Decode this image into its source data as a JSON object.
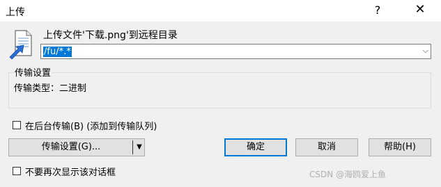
{
  "window": {
    "title": "上传",
    "help_glyph": "?",
    "close_glyph": "✕"
  },
  "header": {
    "icon": "upload-file-icon",
    "text": "上传文件'下载.png'到远程目录"
  },
  "path": {
    "value": "/fu/*.*"
  },
  "settings": {
    "group_title": "传输设置",
    "transfer_type": "传输类型：二进制"
  },
  "options": {
    "background_label": "在后台传输(B) (添加到传输队列)",
    "background_checked": false,
    "no_show_label": "不要再次显示该对话框",
    "no_show_checked": false
  },
  "buttons": {
    "transfer_settings": "传输设置(G)...",
    "ok": "确定",
    "cancel": "取消",
    "help": "帮助(H)"
  },
  "watermark": "CSDN @海鸥爱上鱼",
  "colors": {
    "selection": "#0078d7",
    "default_button_border": "#0078d7",
    "icon_blue": "#2a6fd6"
  }
}
